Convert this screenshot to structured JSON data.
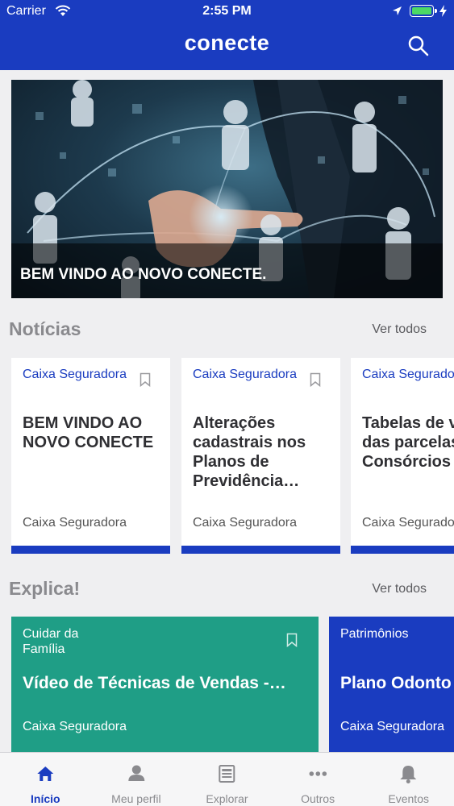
{
  "status_bar": {
    "carrier": "Carrier",
    "time": "2:55 PM"
  },
  "header": {
    "title": "conecte"
  },
  "hero": {
    "caption": "BEM VINDO AO NOVO CONECTE."
  },
  "news": {
    "title": "Notícias",
    "see_all": "Ver todos",
    "cards": [
      {
        "category": "Caixa Seguradora",
        "title": "BEM VINDO AO NOVO CONECTE",
        "source": "Caixa Seguradora"
      },
      {
        "category": "Caixa Seguradora",
        "title": "Alterações cadastrais nos Planos de Previdência…",
        "source": "Caixa Seguradora"
      },
      {
        "category": "Caixa Seguradora",
        "title": "Tabelas de valores das parcelas Consórcios",
        "source": "Caixa Seguradora"
      }
    ]
  },
  "explica": {
    "title": "Explica!",
    "see_all": "Ver todos",
    "cards": [
      {
        "category": "Cuidar da Família",
        "title": "Vídeo de Técnicas de Vendas -…",
        "source": "Caixa Seguradora",
        "color": "#1f9e86"
      },
      {
        "category": "Patrimônios",
        "title": "Plano Odonto",
        "source": "Caixa Seguradora",
        "color": "#1a3cc0"
      }
    ]
  },
  "tabs": [
    {
      "label": "Início",
      "icon": "home-icon",
      "active": true
    },
    {
      "label": "Meu perfil",
      "icon": "person-icon",
      "active": false
    },
    {
      "label": "Explorar",
      "icon": "newspaper-icon",
      "active": false
    },
    {
      "label": "Outros",
      "icon": "more-icon",
      "active": false
    },
    {
      "label": "Eventos",
      "icon": "bell-icon",
      "active": false
    }
  ],
  "colors": {
    "primary": "#1a3cc0",
    "teal": "#1f9e86",
    "background": "#efeff1"
  }
}
